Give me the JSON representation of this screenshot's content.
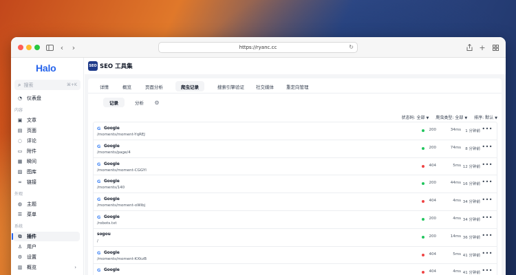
{
  "browser": {
    "url": "https://ryanc.cc"
  },
  "sidebar": {
    "logo": "Halo",
    "search_placeholder": "搜索",
    "search_shortcut": "⌘+K",
    "items": [
      {
        "label": "仪表盘",
        "icon": "dashboard-icon"
      },
      {
        "group": "内容"
      },
      {
        "label": "文章",
        "icon": "book-icon"
      },
      {
        "label": "页面",
        "icon": "page-icon"
      },
      {
        "label": "评论",
        "icon": "comment-icon"
      },
      {
        "label": "附件",
        "icon": "folder-icon"
      },
      {
        "label": "瞬间",
        "icon": "moment-icon"
      },
      {
        "label": "图库",
        "icon": "image-icon"
      },
      {
        "label": "链接",
        "icon": "link-icon"
      },
      {
        "group": "外观"
      },
      {
        "label": "主题",
        "icon": "palette-icon"
      },
      {
        "label": "菜单",
        "icon": "menu-icon"
      },
      {
        "group": "系统"
      },
      {
        "label": "插件",
        "icon": "plugin-icon",
        "active": true
      },
      {
        "label": "用户",
        "icon": "user-icon"
      },
      {
        "label": "设置",
        "icon": "settings-icon"
      },
      {
        "label": "概览",
        "icon": "overview-icon"
      }
    ]
  },
  "plugin": {
    "logo_text": "SEO",
    "title": "SEO 工具集"
  },
  "tabs": [
    "详情",
    "概览",
    "页面分析",
    "爬虫记录",
    "搜索引擎验证",
    "社交媒体",
    "重定向管理"
  ],
  "active_tab": "爬虫记录",
  "subtabs": [
    "记录",
    "分析"
  ],
  "filters": [
    {
      "label": "状态码:",
      "value": "全部"
    },
    {
      "label": "爬虫类型:",
      "value": "全部"
    },
    {
      "label": "排序:",
      "value": "默认"
    }
  ],
  "rows": [
    {
      "engine": "Google",
      "path": "/moments/moment-YqREJ",
      "code": "200",
      "ms": "34ms",
      "ago": "1 分钟前"
    },
    {
      "engine": "Google",
      "path": "/moments/page/4",
      "code": "200",
      "ms": "74ms",
      "ago": "8 分钟前"
    },
    {
      "engine": "Google",
      "path": "/moments/moment-CGGYI",
      "code": "404",
      "ms": "5ms",
      "ago": "12 分钟前"
    },
    {
      "engine": "Google",
      "path": "/moments/140",
      "code": "200",
      "ms": "44ms",
      "ago": "16 分钟前"
    },
    {
      "engine": "Google",
      "path": "/moments/moment-oWibj",
      "code": "404",
      "ms": "4ms",
      "ago": "34 分钟前"
    },
    {
      "engine": "Google",
      "path": "/robots.txt",
      "code": "200",
      "ms": "4ms",
      "ago": "34 分钟前"
    },
    {
      "engine": "sogou",
      "path": "/",
      "code": "200",
      "ms": "14ms",
      "ago": "36 分钟前"
    },
    {
      "engine": "Google",
      "path": "/moments/moment-KXkzB",
      "code": "404",
      "ms": "5ms",
      "ago": "41 分钟前"
    },
    {
      "engine": "Google",
      "path": "",
      "code": "404",
      "ms": "4ms",
      "ago": "41 分钟前"
    }
  ],
  "colors": {
    "accent": "#2563eb",
    "status_ok": "#22c55e",
    "status_error": "#ef4444"
  }
}
